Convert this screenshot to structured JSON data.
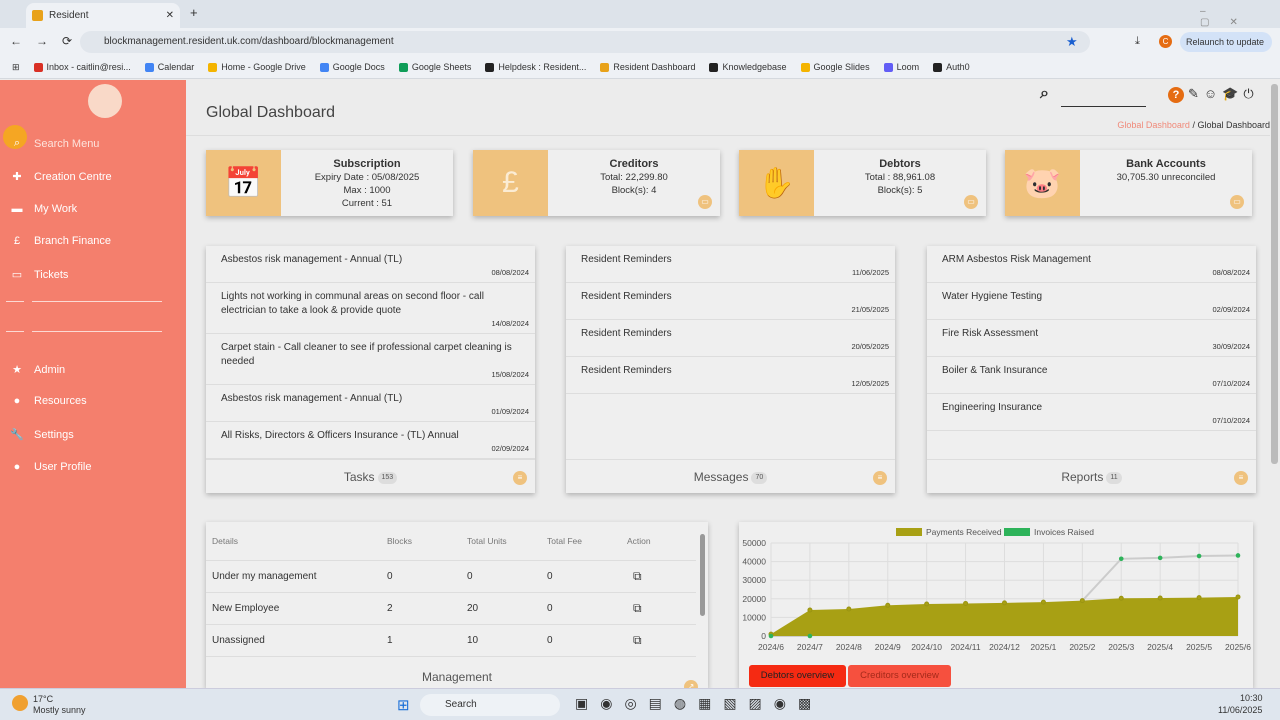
{
  "browser": {
    "tab_title": "Resident",
    "url": "blockmanagement.resident.uk.com/dashboard/blockmanagement",
    "relaunch": "Relaunch to update",
    "profile_initial": "C",
    "bookmarks": [
      {
        "label": "Inbox - caitlin@resi...",
        "color": "#d93025"
      },
      {
        "label": "Calendar",
        "color": "#4285f4"
      },
      {
        "label": "Home - Google Drive",
        "color": "#f4b400"
      },
      {
        "label": "Google Docs",
        "color": "#4285f4"
      },
      {
        "label": "Google Sheets",
        "color": "#0f9d58"
      },
      {
        "label": "Helpdesk : Resident...",
        "color": "#222"
      },
      {
        "label": "Resident Dashboard",
        "color": "#e8a21a"
      },
      {
        "label": "Knowledgebase",
        "color": "#222"
      },
      {
        "label": "Google Slides",
        "color": "#f4b400"
      },
      {
        "label": "Loom",
        "color": "#625df5"
      },
      {
        "label": "Auth0",
        "color": "#222"
      }
    ]
  },
  "sidebar": {
    "items": [
      {
        "label": "Search Menu",
        "icon": "search-icon"
      },
      {
        "label": "Creation Centre",
        "icon": "plus-icon"
      },
      {
        "label": "My Work",
        "icon": "briefcase-icon"
      },
      {
        "label": "Branch Finance",
        "icon": "pound-icon"
      },
      {
        "label": "Tickets",
        "icon": "ticket-icon"
      },
      {
        "label": "Admin",
        "icon": "star-icon"
      },
      {
        "label": "Resources",
        "icon": "lightbulb-icon"
      },
      {
        "label": "Settings",
        "icon": "wrench-icon"
      },
      {
        "label": "User Profile",
        "icon": "user-icon"
      }
    ]
  },
  "header": {
    "title": "Global Dashboard",
    "breadcrumb": [
      "Global Dashboard",
      "Global Dashboard"
    ]
  },
  "cards": [
    {
      "title": "Subscription",
      "lines": [
        "Expiry Date : 05/08/2025",
        "Max : 1000",
        "Current : 51"
      ],
      "icon": "calendar-clock-icon"
    },
    {
      "title": "Creditors",
      "lines": [
        "Total: 22,299.80",
        "Block(s): 4"
      ],
      "icon": "pound-file-icon"
    },
    {
      "title": "Debtors",
      "lines": [
        "Total : 88,961.08",
        "Block(s): 5"
      ],
      "icon": "hand-coins-icon"
    },
    {
      "title": "Bank Accounts",
      "lines": [
        "30,705.30 unreconciled"
      ],
      "icon": "piggy-bank-icon"
    }
  ],
  "panels": [
    {
      "title": "Tasks",
      "count": "153",
      "items": [
        {
          "text": "Asbestos risk management - Annual (TL)",
          "date": "08/08/2024"
        },
        {
          "text": "Lights not working in communal areas on second floor - call electrician to take a look & provide quote",
          "date": "14/08/2024"
        },
        {
          "text": "Carpet stain - Call cleaner to see if professional carpet cleaning is needed",
          "date": "15/08/2024"
        },
        {
          "text": "Asbestos risk management - Annual (TL)",
          "date": "01/09/2024"
        },
        {
          "text": "All Risks, Directors & Officers Insurance - (TL) Annual",
          "date": "02/09/2024"
        }
      ]
    },
    {
      "title": "Messages",
      "count": "70",
      "items": [
        {
          "text": "Resident Reminders",
          "date": "11/06/2025"
        },
        {
          "text": "Resident Reminders",
          "date": "21/05/2025"
        },
        {
          "text": "Resident Reminders",
          "date": "20/05/2025"
        },
        {
          "text": "Resident Reminders",
          "date": "12/05/2025"
        }
      ]
    },
    {
      "title": "Reports",
      "count": "11",
      "items": [
        {
          "text": "ARM Asbestos Risk Management",
          "date": "08/08/2024"
        },
        {
          "text": "Water Hygiene Testing",
          "date": "02/09/2024"
        },
        {
          "text": "Fire Risk Assessment",
          "date": "30/09/2024"
        },
        {
          "text": "Boiler & Tank Insurance",
          "date": "07/10/2024"
        },
        {
          "text": "Engineering Insurance",
          "date": "07/10/2024"
        }
      ]
    }
  ],
  "management": {
    "title": "Management",
    "headers": [
      "Details",
      "Blocks",
      "Total Units",
      "Total Fee",
      "Action"
    ],
    "rows": [
      [
        "Under my management",
        "0",
        "0",
        "0"
      ],
      [
        "New Employee",
        "2",
        "20",
        "0"
      ],
      [
        "Unassigned",
        "1",
        "10",
        "0"
      ]
    ]
  },
  "chart_data": {
    "type": "area",
    "categories": [
      "2024/6",
      "2024/7",
      "2024/8",
      "2024/9",
      "2024/10",
      "2024/11",
      "2024/12",
      "2025/1",
      "2025/2",
      "2025/3",
      "2025/4",
      "2025/5",
      "2025/6"
    ],
    "ylim": [
      0,
      50000
    ],
    "yticks": [
      0,
      10000,
      20000,
      30000,
      40000,
      50000
    ],
    "grid": true,
    "legend": "top",
    "series": [
      {
        "name": "Payments Received",
        "color": "#a8a014",
        "values": [
          1000,
          14000,
          14500,
          16500,
          17200,
          17500,
          17800,
          18200,
          19000,
          20300,
          20400,
          20600,
          21000
        ]
      },
      {
        "name": "Invoices Raised",
        "color": "#2eb35a",
        "values": [
          0,
          0,
          null,
          null,
          null,
          null,
          null,
          null,
          19000,
          41500,
          42000,
          43000,
          43300
        ]
      }
    ]
  },
  "chart_buttons": {
    "debtors": "Debtors overview",
    "creditors": "Creditors overview"
  },
  "taskbar": {
    "temp": "17°C",
    "weather": "Mostly sunny",
    "search": "Search",
    "time": "10:30",
    "date": "11/06/2025"
  }
}
